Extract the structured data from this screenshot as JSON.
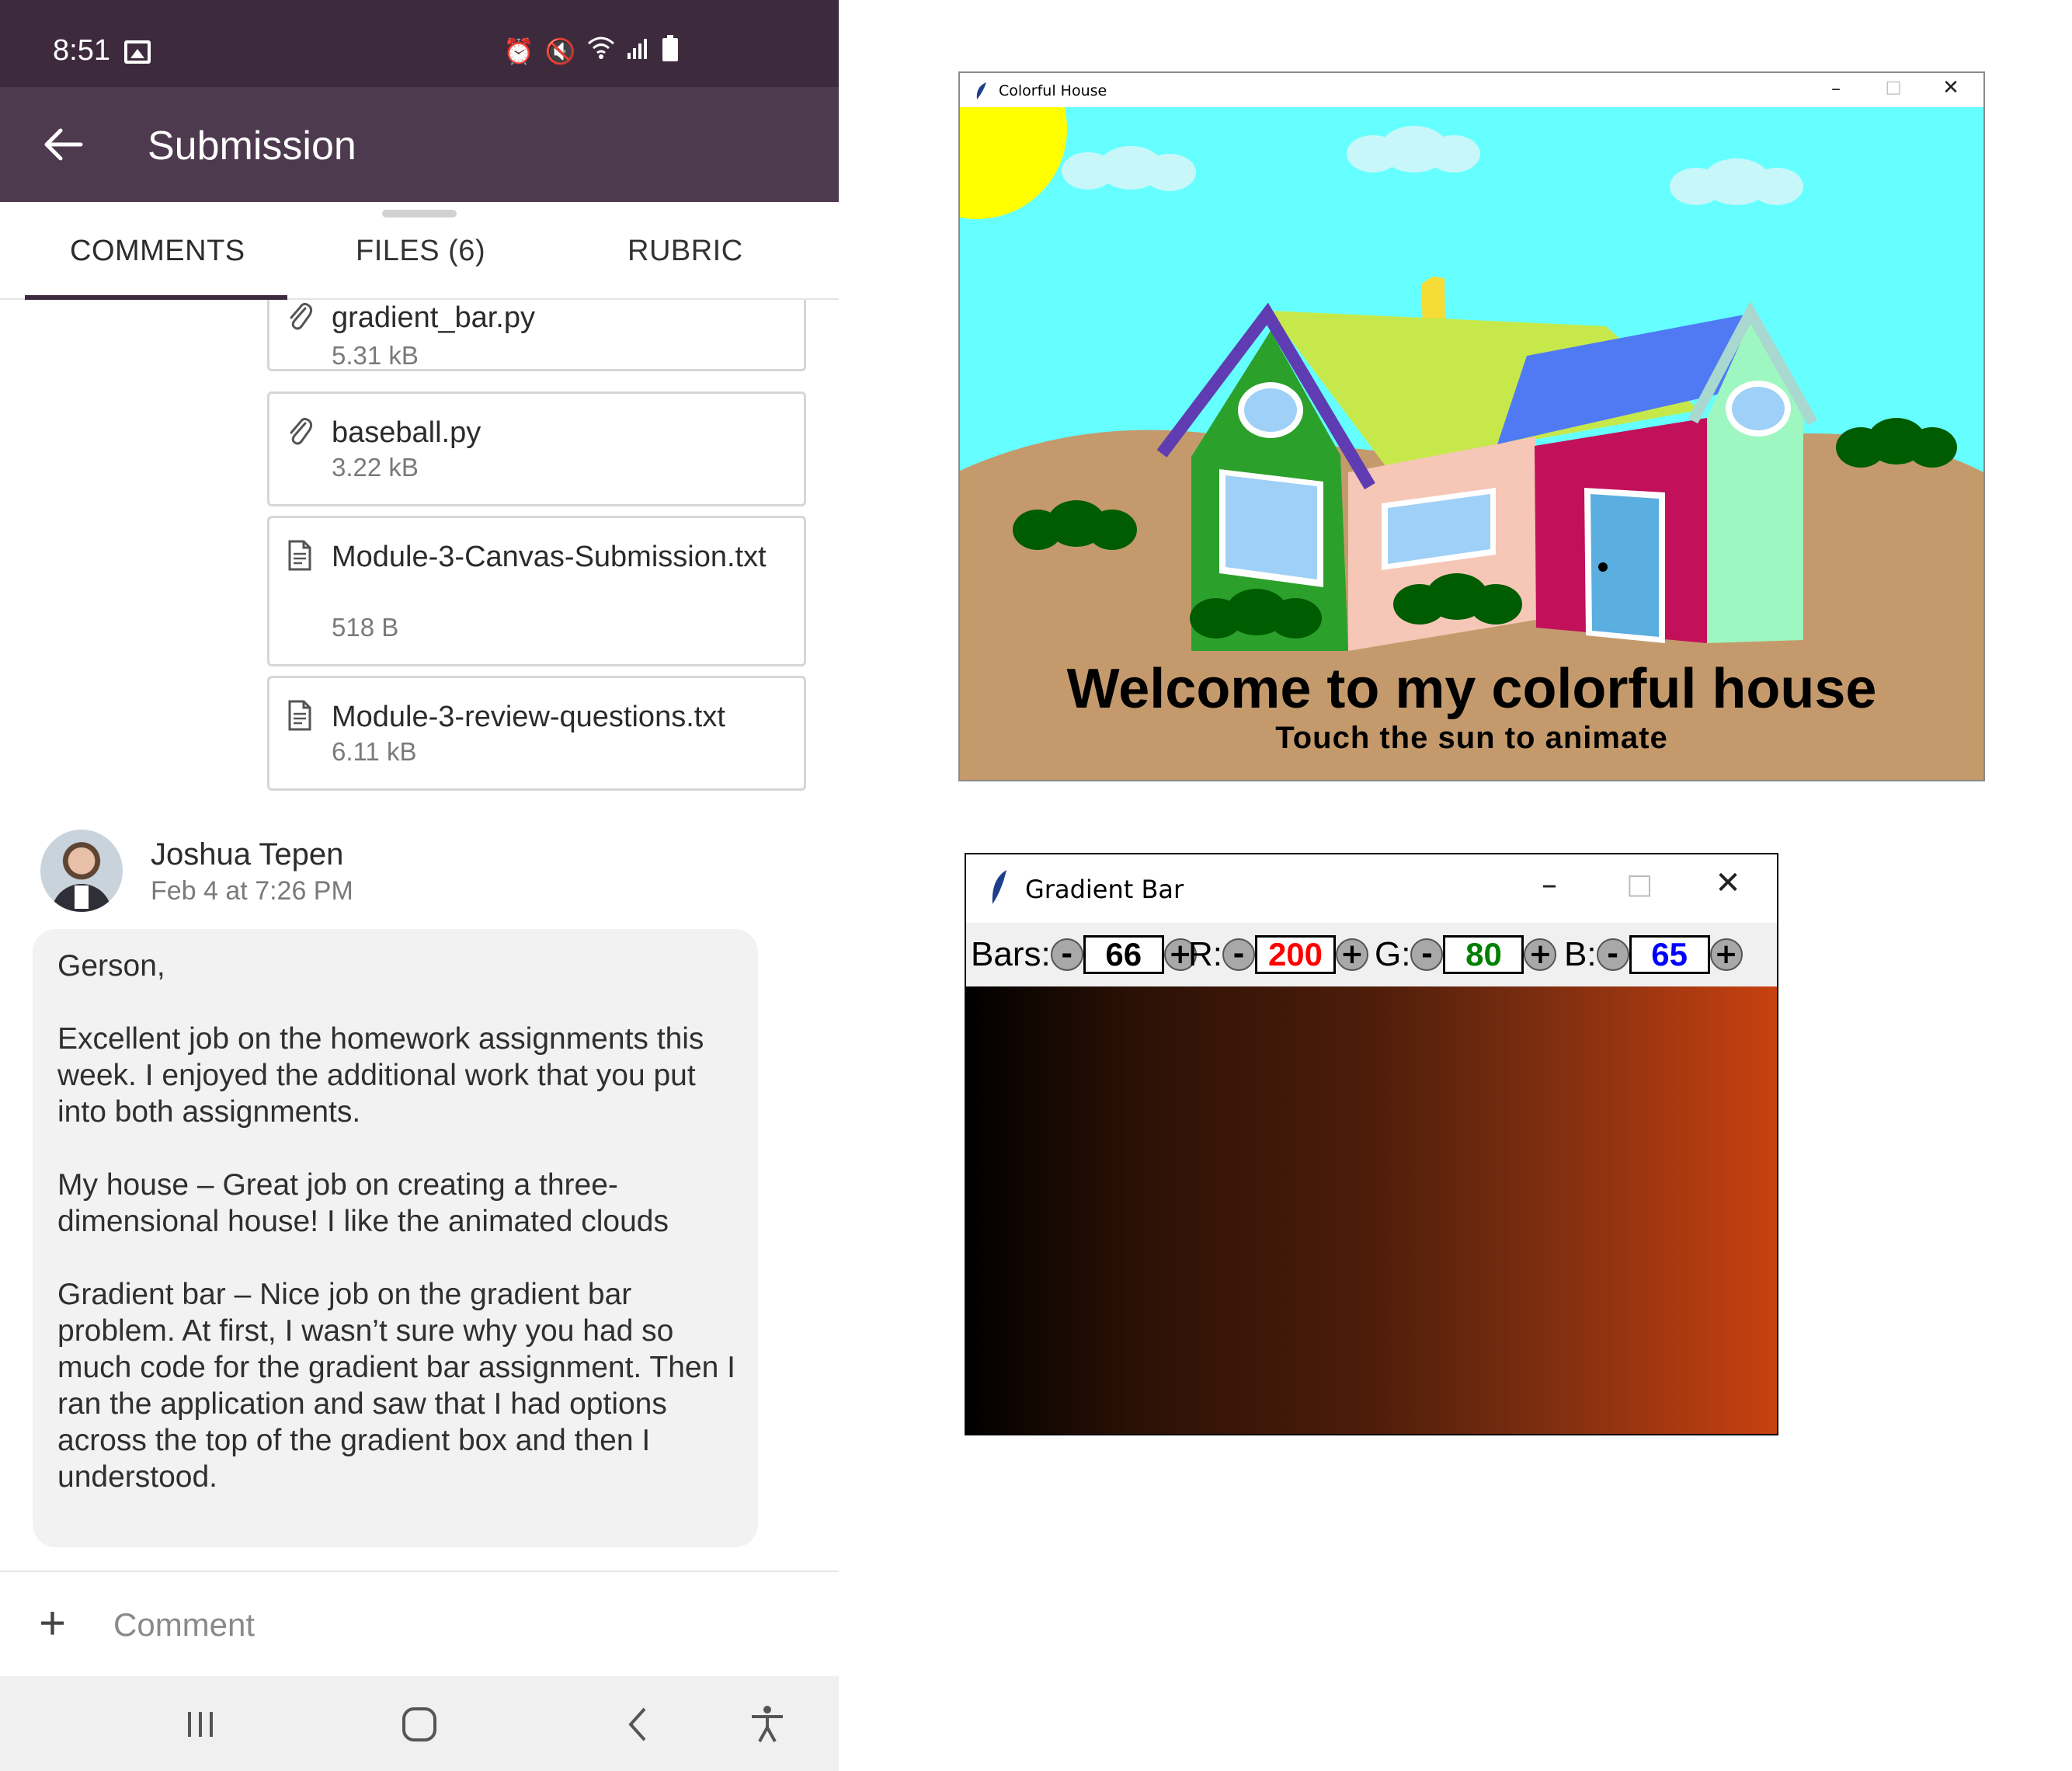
{
  "status_bar": {
    "time": "8:51"
  },
  "app_bar": {
    "title": "Submission"
  },
  "tabs": [
    {
      "label": "COMMENTS"
    },
    {
      "label": "FILES (6)"
    },
    {
      "label": "RUBRIC"
    }
  ],
  "files": [
    {
      "name": "gradient_bar.py",
      "size": "5.31 kB",
      "icon": "paperclip-icon"
    },
    {
      "name": "baseball.py",
      "size": "3.22 kB",
      "icon": "paperclip-icon"
    },
    {
      "name": "Module-3-Canvas-Submission.txt",
      "size": "518 B",
      "icon": "document-icon"
    },
    {
      "name": "Module-3-review-questions.txt",
      "size": "6.11 kB",
      "icon": "document-icon"
    }
  ],
  "comment": {
    "author": "Joshua Tepen",
    "date": "Feb 4 at 7:26 PM",
    "message": "Gerson,\n\nExcellent job on the homework assignments this week.  I enjoyed the additional work that you put into both assignments.\n\nMy house – Great job on creating a three-dimensional house!  I like the animated clouds\n\nGradient bar – Nice job on the gradient bar problem.  At first, I wasn’t sure why you had so much code for the gradient bar assignment.  Then I ran the application and saw that I had options across the top of the gradient box and then I understood."
  },
  "comment_input": {
    "placeholder": "Comment"
  },
  "house_window": {
    "title": "Colorful House",
    "welcome_text": "Welcome to my colorful house",
    "subtitle_text": "Touch the sun to animate"
  },
  "gradient_window": {
    "title": "Gradient Bar",
    "controls": [
      {
        "label": "Bars:",
        "value": "66",
        "color": "#000000"
      },
      {
        "label": "R:",
        "value": "200",
        "color": "#ff0000"
      },
      {
        "label": "G:",
        "value": "80",
        "color": "#008000"
      },
      {
        "label": "B:",
        "value": "65",
        "color": "#0000ff"
      }
    ],
    "minus": "-",
    "plus": "+"
  },
  "colors": {
    "status_bar": "#3d2b3d",
    "app_bar": "#4e3a4e",
    "sky": "#66ffff",
    "sun": "#ffff00",
    "ground": "#c49a6c",
    "gradient_end": "#c84110"
  }
}
